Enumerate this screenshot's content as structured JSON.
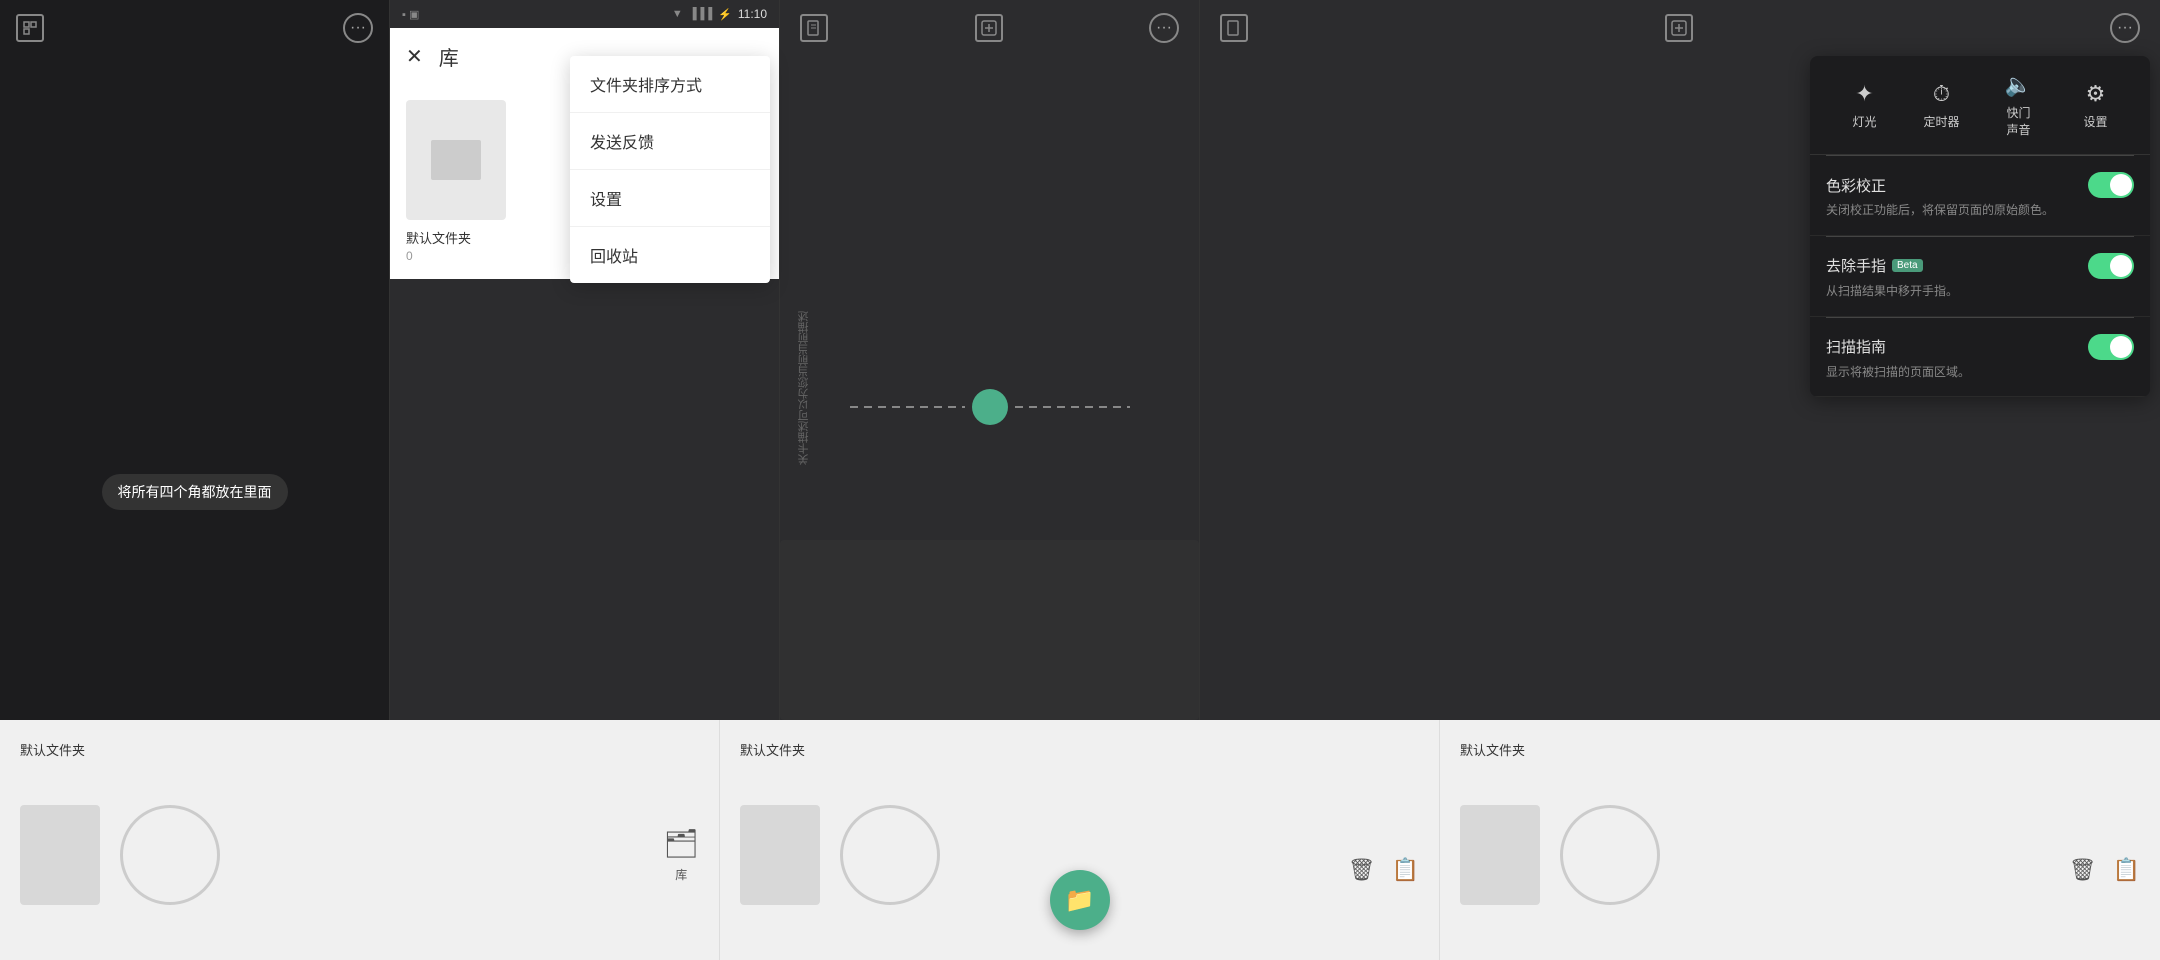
{
  "panel1": {
    "tooltip": "将所有四个角都放在里面"
  },
  "panel2": {
    "title": "库",
    "status_time": "11:10",
    "folder_name": "默认文件夹",
    "folder_count": "0",
    "dropdown": {
      "items": [
        "文件夹排序方式",
        "发送反馈",
        "设置",
        "回收站"
      ]
    }
  },
  "panel3": {
    "folder_label": "默认文件夹",
    "vertical_text": "关卡描述可以为您当前当前描述"
  },
  "panel4": {
    "folder_label": "默认文件夹",
    "settings": {
      "toolbar": [
        {
          "label": "灯光",
          "icon": "✦"
        },
        {
          "label": "定时器",
          "icon": "⏱"
        },
        {
          "label": "快门\n声音",
          "icon": "🔈"
        },
        {
          "label": "设置",
          "icon": "⚙"
        }
      ],
      "items": [
        {
          "title": "色彩校正",
          "description": "关闭校正功能后，将保留页面的原始颜色。",
          "enabled": true,
          "beta": false
        },
        {
          "title": "去除手指",
          "description": "从扫描结果中移开手指。",
          "enabled": true,
          "beta": true
        },
        {
          "title": "扫描指南",
          "description": "显示将被扫描的页面区域。",
          "enabled": true,
          "beta": false
        }
      ]
    }
  },
  "bottom": {
    "sections": [
      {
        "folder_label": "默认文件夹",
        "has_fab": false,
        "has_library": true
      },
      {
        "folder_label": "默认文件夹",
        "has_fab": true,
        "has_library": false
      },
      {
        "folder_label": "默认文件夹",
        "has_fab": false,
        "has_library": false
      }
    ],
    "library_label": "库"
  }
}
